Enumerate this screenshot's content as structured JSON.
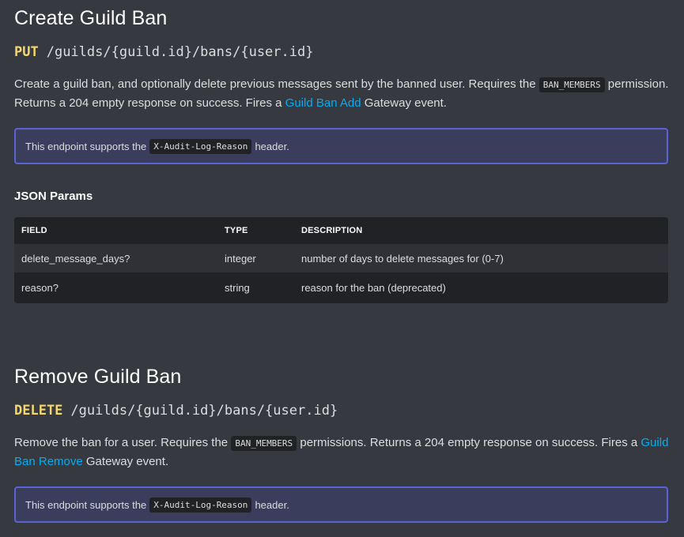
{
  "section1": {
    "title": "Create Guild Ban",
    "method": "PUT",
    "path": "/guilds/{guild.id}/bans/{user.id}",
    "desc_part1": "Create a guild ban, and optionally delete previous messages sent by the banned user. Requires the ",
    "desc_code": "BAN_MEMBERS",
    "desc_part2": " permission. Returns a 204 empty response on success. Fires a ",
    "desc_link": "Guild Ban Add",
    "desc_part3": " Gateway event.",
    "notice_prefix": "This endpoint supports the ",
    "notice_code": "X-Audit-Log-Reason",
    "notice_suffix": " header."
  },
  "params": {
    "heading": "JSON Params",
    "columns": [
      "FIELD",
      "TYPE",
      "DESCRIPTION"
    ],
    "rows": [
      {
        "field": "delete_message_days?",
        "type": "integer",
        "description": "number of days to delete messages for (0-7)"
      },
      {
        "field": "reason?",
        "type": "string",
        "description": "reason for the ban (deprecated)"
      }
    ]
  },
  "section2": {
    "title": "Remove Guild Ban",
    "method": "DELETE",
    "path": "/guilds/{guild.id}/bans/{user.id}",
    "desc_part1": "Remove the ban for a user. Requires the ",
    "desc_code": "BAN_MEMBERS",
    "desc_part2": " permissions. Returns a 204 empty response on success. Fires a ",
    "desc_link": "Guild Ban Remove",
    "desc_part3": " Gateway event.",
    "notice_prefix": "This endpoint supports the ",
    "notice_code": "X-Audit-Log-Reason",
    "notice_suffix": " header."
  },
  "colors": {
    "background": "#36393f",
    "method": "#f5d76e",
    "link": "#00aff4",
    "notice_border": "#5a63d6",
    "notice_bg": "#3a3e5c"
  }
}
